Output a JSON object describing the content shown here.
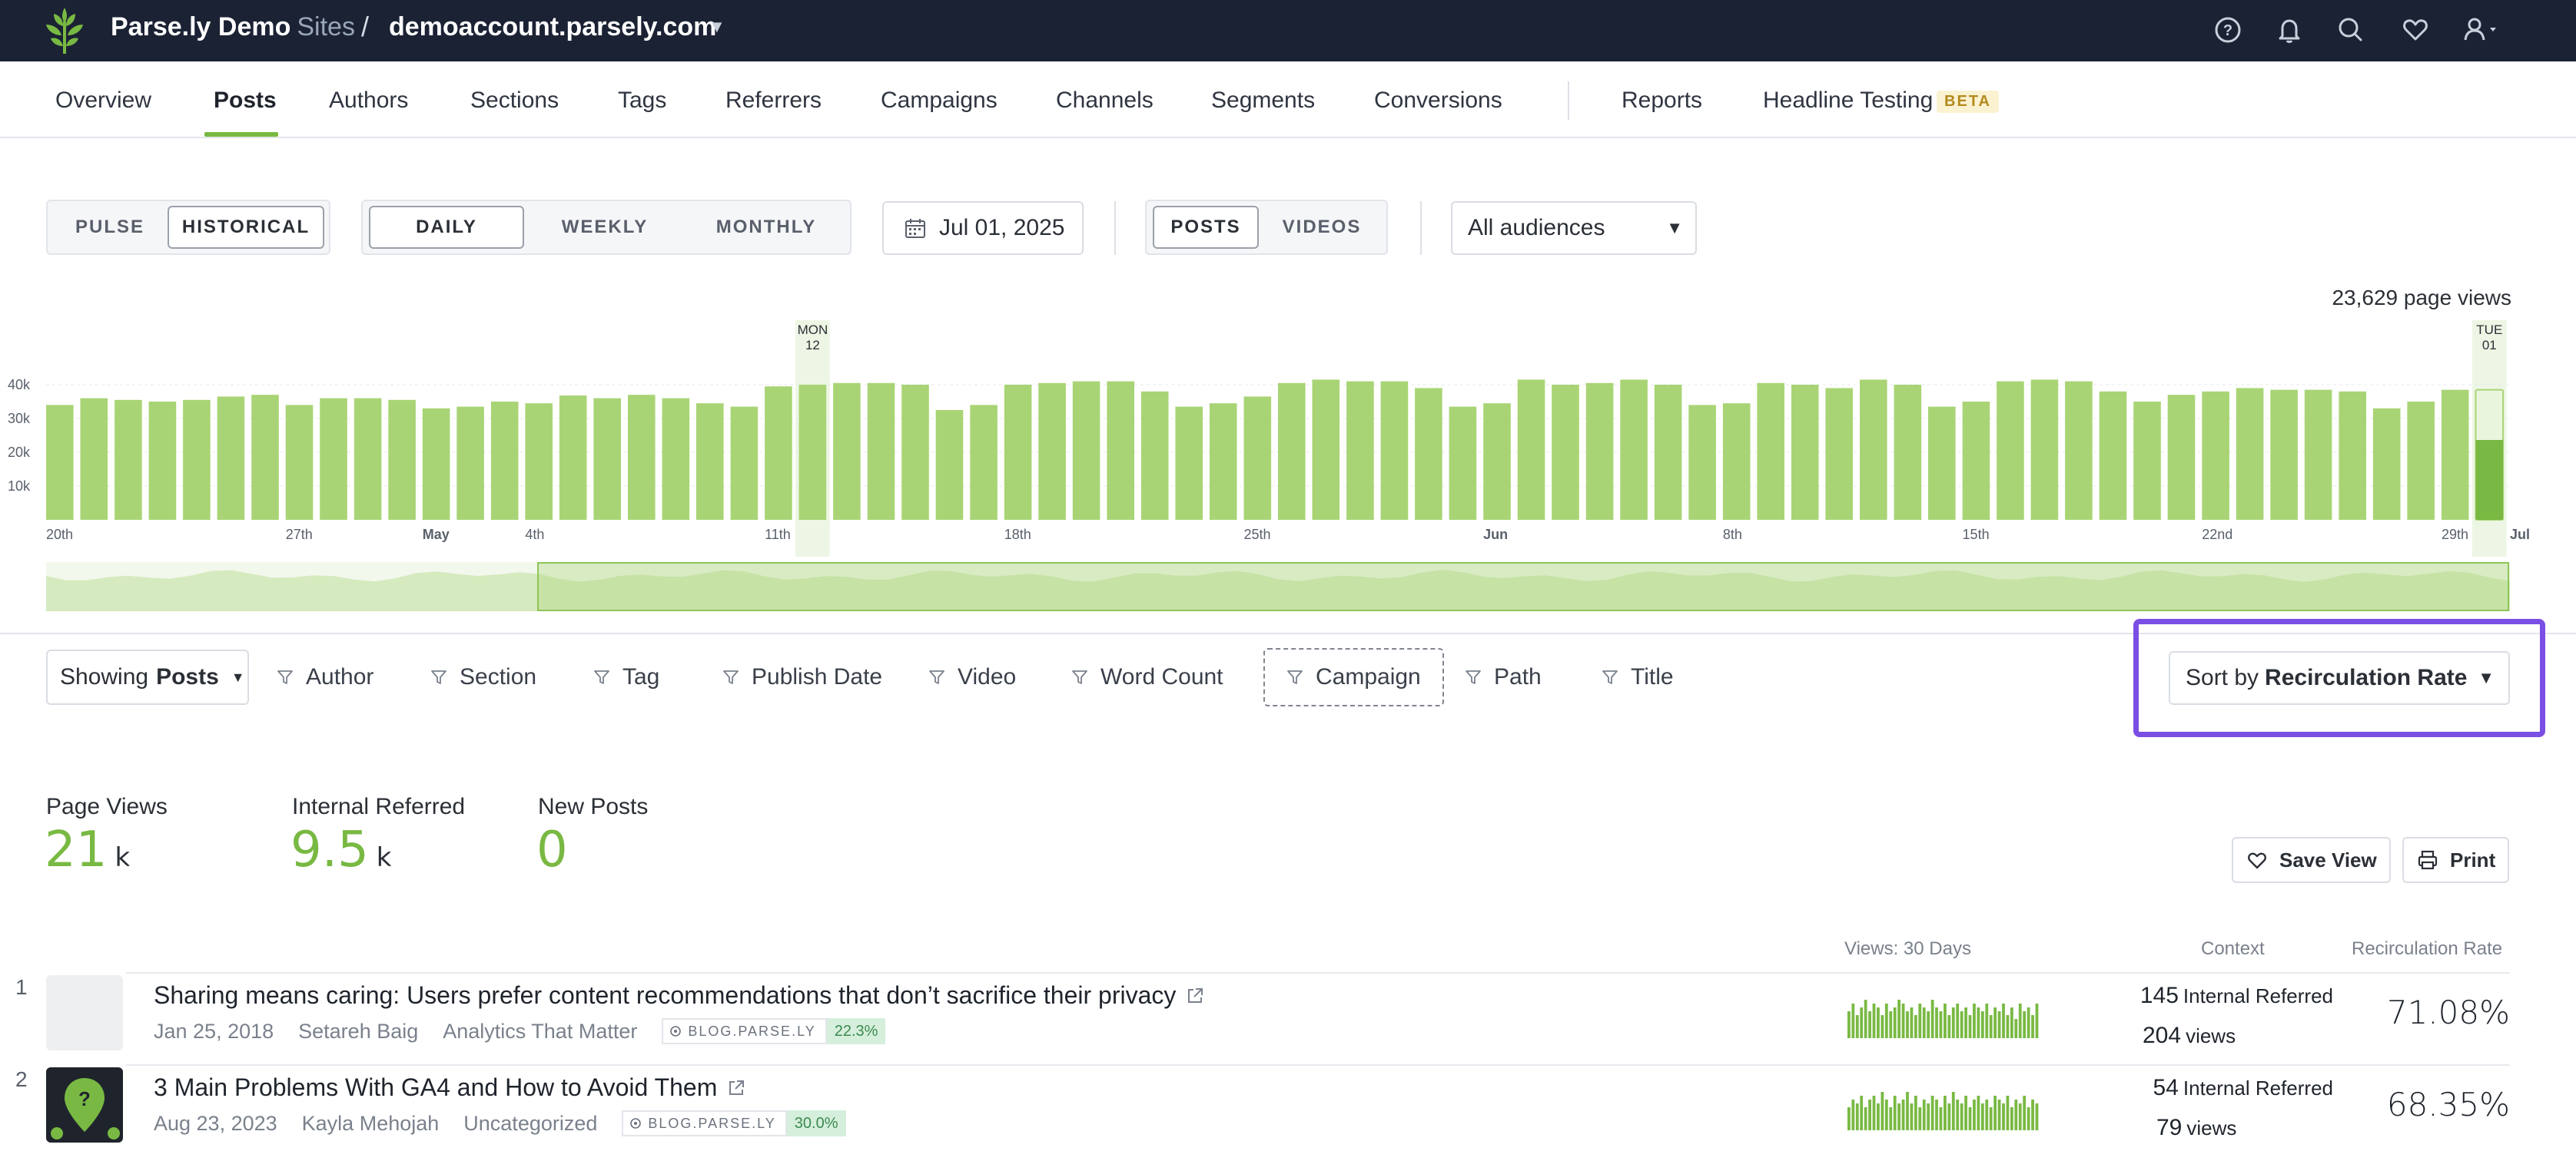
{
  "topbar": {
    "brand": "Parse.ly Demo",
    "sites": "Sites",
    "separator": "/",
    "account": "demoaccount.parsely.com",
    "icons": [
      "help-icon",
      "bell-icon",
      "search-icon",
      "heart-icon",
      "user-icon"
    ]
  },
  "nav": {
    "items": [
      "Overview",
      "Posts",
      "Authors",
      "Sections",
      "Tags",
      "Referrers",
      "Campaigns",
      "Channels",
      "Segments",
      "Conversions",
      "Reports",
      "Headline Testing"
    ],
    "active": "Posts",
    "beta": "BETA"
  },
  "controls": {
    "mode": [
      "PULSE",
      "HISTORICAL"
    ],
    "interval": [
      "DAILY",
      "WEEKLY",
      "MONTHLY"
    ],
    "date": "Jul 01, 2025",
    "content": [
      "POSTS",
      "VIDEOS"
    ],
    "audience": "All audiences"
  },
  "chart_data": {
    "type": "bar",
    "title": "23,629 page views",
    "xlabel": "",
    "ylabel": "",
    "ylim": [
      0,
      40000
    ],
    "yticks": [
      "10k",
      "20k",
      "30k",
      "40k"
    ],
    "x_tick_labels": [
      "20th",
      "27th",
      "May",
      "4th",
      "11th",
      "18th",
      "25th",
      "Jun",
      "8th",
      "15th",
      "22nd",
      "29th",
      "Jul"
    ],
    "markers": [
      {
        "day": "MON",
        "date": "12"
      },
      {
        "day": "TUE",
        "date": "01"
      }
    ],
    "values": [
      34000,
      36000,
      35500,
      35000,
      35500,
      36500,
      37000,
      34000,
      36000,
      36000,
      35500,
      33000,
      33500,
      35000,
      34500,
      36800,
      36000,
      37000,
      36000,
      34500,
      33500,
      39500,
      40000,
      40500,
      40500,
      40000,
      32500,
      34000,
      40000,
      40500,
      41000,
      41000,
      38000,
      33500,
      34500,
      36500,
      40500,
      41500,
      41000,
      41000,
      39000,
      33500,
      34500,
      41500,
      40000,
      40500,
      41500,
      40000,
      34000,
      34500,
      40500,
      40000,
      39000,
      41500,
      40000,
      33500,
      35000,
      41000,
      41500,
      41000,
      38000,
      35000,
      37000,
      38000,
      39000,
      38500,
      38500,
      38000,
      33000,
      35000,
      38500
    ],
    "last_value": 23629
  },
  "filters": {
    "showing_prefix": "Showing",
    "showing_value": "Posts",
    "items": [
      "Author",
      "Section",
      "Tag",
      "Publish Date",
      "Video",
      "Word Count",
      "Campaign",
      "Path",
      "Title"
    ],
    "sort_prefix": "Sort by",
    "sort_value": "Recirculation Rate"
  },
  "metrics": [
    {
      "label": "Page Views",
      "value": "21",
      "unit": "k"
    },
    {
      "label": "Internal Referred",
      "value": "9.5",
      "unit": "k"
    },
    {
      "label": "New Posts",
      "value": "0",
      "unit": ""
    }
  ],
  "actions": {
    "save": "Save View",
    "print": "Print"
  },
  "table": {
    "headers": {
      "views": "Views: 30 Days",
      "context": "Context",
      "rate": "Recirculation Rate"
    },
    "rows": [
      {
        "rank": "1",
        "title": "Sharing means caring: Users prefer content recommendations that don’t sacrifice their privacy",
        "date": "Jan 25, 2018",
        "author": "Setareh Baig",
        "section": "Analytics That Matter",
        "site": "BLOG.PARSE.LY",
        "pct": "22.3%",
        "internal": "145",
        "internal_label": "Internal Referred",
        "views": "204",
        "views_label": "views",
        "rate": "71.08%",
        "spark": [
          0.7,
          0.9,
          0.6,
          0.8,
          1.0,
          0.7,
          0.9,
          0.8,
          0.6,
          0.9,
          0.7,
          0.8,
          1.0,
          0.9,
          0.7,
          0.8,
          0.6,
          0.9,
          0.8,
          0.7,
          1.0,
          0.8,
          0.7,
          0.9,
          0.6,
          0.8,
          0.9,
          0.7,
          0.8,
          0.6,
          0.9,
          0.8,
          0.7,
          0.9,
          0.6,
          0.8,
          0.7,
          0.9,
          0.6,
          0.8,
          0.5,
          0.9,
          0.7,
          0.8,
          0.6,
          0.9
        ]
      },
      {
        "rank": "2",
        "title": "3 Main Problems With GA4 and How to Avoid Them",
        "date": "Aug 23, 2023",
        "author": "Kayla Mehojah",
        "section": "Uncategorized",
        "site": "BLOG.PARSE.LY",
        "pct": "30.0%",
        "internal": "54",
        "internal_label": "Internal Referred",
        "views": "79",
        "views_label": "views",
        "rate": "68.35%",
        "spark": [
          0.6,
          0.8,
          0.7,
          0.9,
          0.6,
          0.8,
          0.9,
          0.7,
          1.0,
          0.8,
          0.6,
          0.9,
          0.7,
          0.8,
          1.0,
          0.7,
          0.9,
          0.6,
          0.8,
          0.7,
          0.9,
          0.8,
          0.6,
          0.9,
          0.7,
          1.0,
          0.8,
          0.7,
          0.9,
          0.6,
          0.8,
          0.9,
          0.7,
          0.8,
          0.6,
          0.9,
          0.8,
          0.7,
          0.9,
          0.6,
          0.8,
          0.7,
          0.9,
          0.6,
          0.8,
          0.7
        ]
      }
    ]
  },
  "colors": {
    "accent": "#79b943",
    "topbar": "#1b2234",
    "highlight": "#7b4fe3"
  }
}
